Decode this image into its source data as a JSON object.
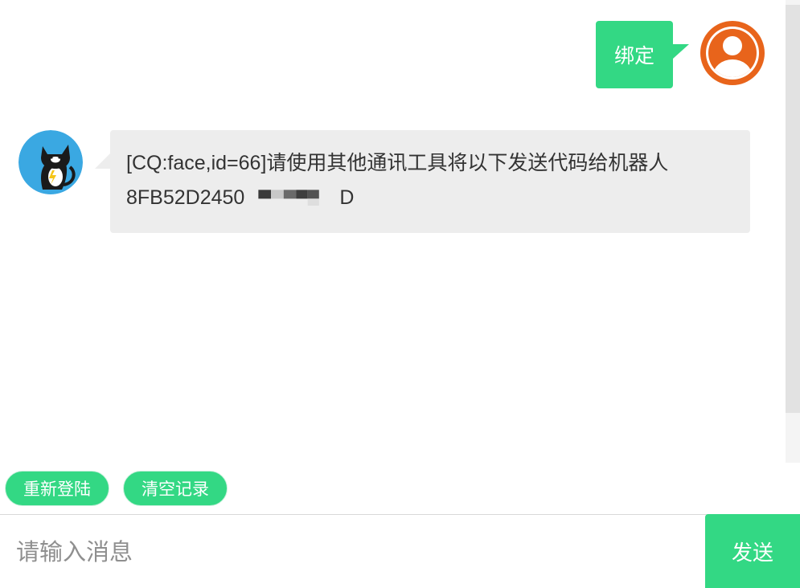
{
  "chat": {
    "outgoing": {
      "text": "绑定",
      "avatar": "user-avatar-icon"
    },
    "incoming": {
      "line1": "[CQ:face,id=66]请使用其他通讯工具将以下发送代码给机器人",
      "line2_visible_start": "8FB52D2450",
      "line2_visible_end": "D",
      "avatar": "cat-avatar"
    }
  },
  "actions": {
    "relogin_label": "重新登陆",
    "clear_label": "清空记录"
  },
  "composer": {
    "placeholder": "请输入消息",
    "send_label": "发送"
  },
  "colors": {
    "accent": "#33d884",
    "avatar_orange": "#e8641b",
    "bubble_gray": "#ededed"
  }
}
